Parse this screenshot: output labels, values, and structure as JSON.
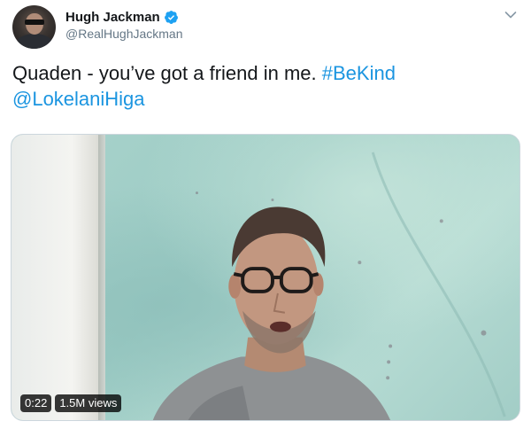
{
  "author": {
    "display_name": "Hugh Jackman",
    "handle": "@RealHughJackman",
    "verified": true,
    "avatar_icon": "profile-photo"
  },
  "tweet": {
    "text_plain": "Quaden - you’ve got a friend in me. ",
    "hashtag": "#BeKind",
    "mention": "@LokelaniHiga"
  },
  "media": {
    "type": "video",
    "duration": "0:22",
    "views": "1.5M views"
  },
  "colors": {
    "link": "#1b95e0",
    "verified_badge": "#1da1f2",
    "secondary_text": "#657786"
  },
  "icons": {
    "menu_caret": "chevron-down-icon",
    "verified": "verified-badge-icon"
  }
}
